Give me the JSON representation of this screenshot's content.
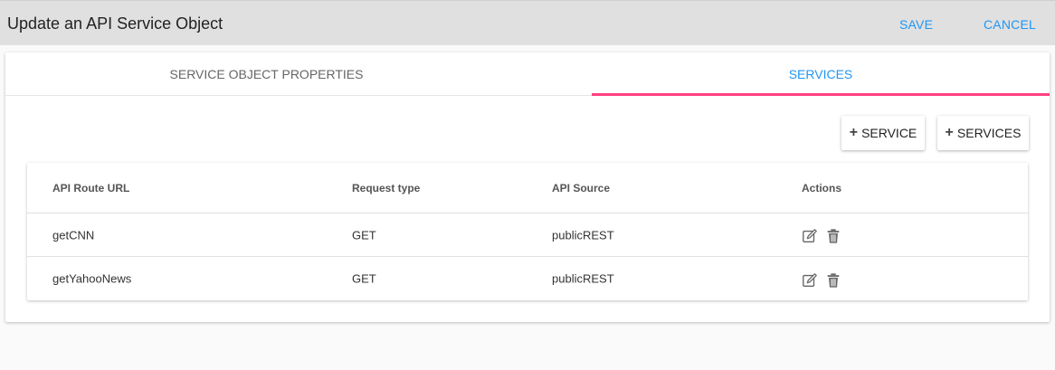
{
  "header": {
    "title": "Update an API Service Object",
    "save_label": "SAVE",
    "cancel_label": "CANCEL"
  },
  "tabs": [
    {
      "label": "SERVICE OBJECT PROPERTIES",
      "active": false
    },
    {
      "label": "SERVICES",
      "active": true
    }
  ],
  "buttons": {
    "add_service": "SERVICE",
    "add_services": "SERVICES",
    "add_icon": "plus-icon"
  },
  "table": {
    "columns": [
      "API Route URL",
      "Request type",
      "API Source",
      "Actions"
    ],
    "rows": [
      {
        "url": "getCNN",
        "type": "GET",
        "source": "publicREST",
        "actions": [
          "edit-icon",
          "delete-icon"
        ]
      },
      {
        "url": "getYahooNews",
        "type": "GET",
        "source": "publicREST",
        "actions": [
          "edit-icon",
          "delete-icon"
        ]
      }
    ]
  },
  "colors": {
    "accent": "#2196f3",
    "tab_indicator": "#ff4081",
    "topbar_bg": "#e0e0e0"
  }
}
